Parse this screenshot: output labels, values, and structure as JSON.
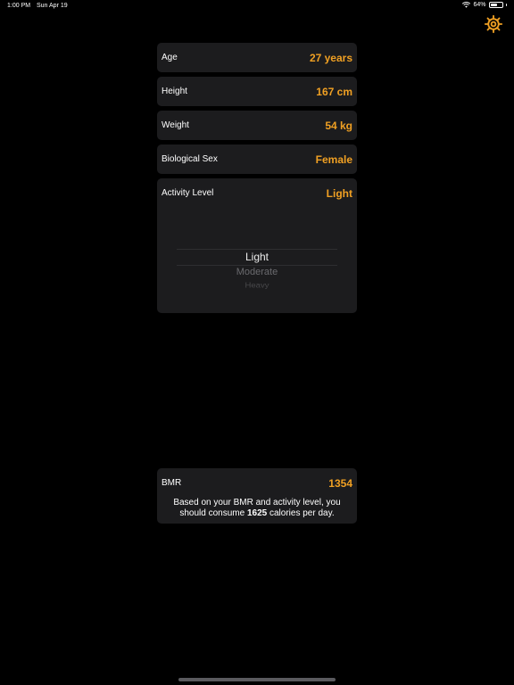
{
  "status_bar": {
    "time": "1:00 PM",
    "date": "Sun Apr 19",
    "battery_percent": "64%",
    "battery_level": 0.64
  },
  "rows": {
    "age": {
      "label": "Age",
      "value": "27 years"
    },
    "height": {
      "label": "Height",
      "value": "167 cm"
    },
    "weight": {
      "label": "Weight",
      "value": "54 kg"
    },
    "sex": {
      "label": "Biological Sex",
      "value": "Female"
    },
    "activity": {
      "label": "Activity Level",
      "value": "Light"
    }
  },
  "picker": {
    "options": [
      "Light",
      "Moderate",
      "Heavy"
    ],
    "selected": "Light"
  },
  "bmr": {
    "label": "BMR",
    "value": "1354",
    "desc_before": "Based on your BMR and activity level, you should consume ",
    "calories": "1625",
    "desc_after": " calories per day."
  },
  "colors": {
    "accent": "#f0a023",
    "card": "#1c1c1e",
    "background": "#000000"
  },
  "icons": {
    "settings": "gear-icon",
    "wifi": "wifi-icon",
    "battery": "battery-icon"
  }
}
